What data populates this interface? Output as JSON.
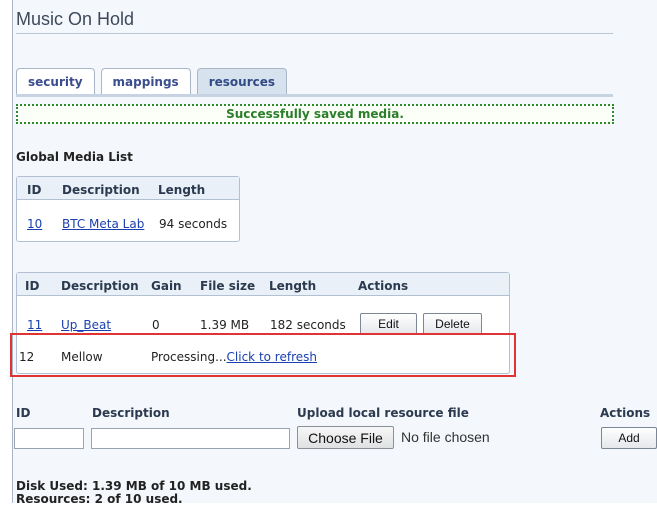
{
  "page": {
    "title": "Music On Hold"
  },
  "tabs": [
    {
      "label": "security",
      "active": false
    },
    {
      "label": "mappings",
      "active": false
    },
    {
      "label": "resources",
      "active": true
    }
  ],
  "notice": {
    "text": "Successfully saved media.",
    "color": "#2a7e2a"
  },
  "global_media": {
    "label": "Global Media List",
    "headers": [
      "ID",
      "Description",
      "Length"
    ],
    "rows": [
      {
        "id": "10",
        "description": "BTC Meta Lab",
        "length": "94 seconds"
      }
    ]
  },
  "resources": {
    "headers": [
      "ID",
      "Description",
      "Gain",
      "File size",
      "Length",
      "Actions"
    ],
    "rows": [
      {
        "id": "11",
        "description": "Up_Beat",
        "gain": "0",
        "size": "1.39 MB",
        "length": "182 seconds",
        "edit": "Edit",
        "delete": "Delete"
      },
      {
        "id": "12",
        "description": "Mellow",
        "status": "Processing...",
        "refresh": "Click to refresh"
      }
    ]
  },
  "upload": {
    "headers": [
      "ID",
      "Description",
      "Upload local resource file",
      "Actions"
    ],
    "choose_label": "Choose File",
    "no_file": "No file chosen",
    "add_label": "Add"
  },
  "footer": {
    "disk": "Disk Used: 1.39 MB of 10 MB used.",
    "resources": "Resources: 2 of 10 used."
  },
  "colors": {
    "highlight": "#e03333",
    "link": "#1a3fb0",
    "tab_active": "#d7e2ef"
  }
}
